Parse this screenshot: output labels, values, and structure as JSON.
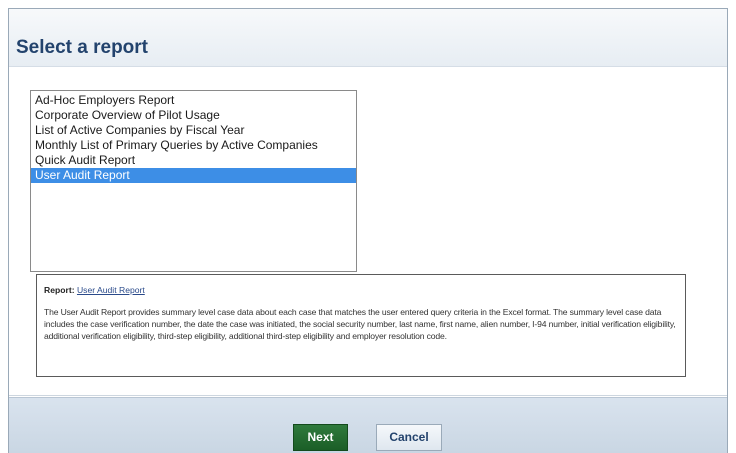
{
  "page": {
    "title": "Select a report"
  },
  "report_list": {
    "items": [
      "Ad-Hoc Employers Report",
      "Corporate Overview of Pilot Usage",
      "List of Active Companies by Fiscal Year",
      "Monthly List of Primary Queries by Active Companies",
      "Quick Audit Report",
      "User Audit Report"
    ],
    "selected": "User Audit Report"
  },
  "description": {
    "label": "Report:",
    "report_name": "User Audit Report",
    "text": "The User Audit Report provides summary level case data about each case that matches the user entered query criteria in the Excel format. The summary level case data includes the case verification number, the date the case was initiated, the social security number, last name, first name, alien number, I-94 number, initial verification eligibility, additional verification eligibility, third-step eligibility, additional third-step eligibility and employer resolution code."
  },
  "footer": {
    "next_label": "Next",
    "cancel_label": "Cancel"
  },
  "colors": {
    "title": "#23436d",
    "selected_item_bg": "#3d8ee6",
    "next_button_bg": "#1b5e27",
    "footer_bg": "#c9d6e3"
  }
}
